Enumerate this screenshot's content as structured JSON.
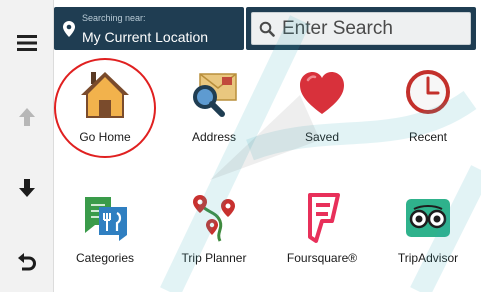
{
  "location": {
    "caption": "Searching near:",
    "value": "My Current Location"
  },
  "search": {
    "placeholder": "Enter Search"
  },
  "rail": {
    "icons": [
      "menu-icon",
      "up-arrow-icon",
      "down-arrow-icon",
      "back-icon"
    ]
  },
  "tiles": [
    {
      "label": "Go Home",
      "icon": "home-icon",
      "selected": true
    },
    {
      "label": "Address",
      "icon": "address-icon"
    },
    {
      "label": "Saved",
      "icon": "heart-icon"
    },
    {
      "label": "Recent",
      "icon": "clock-icon"
    },
    {
      "label": "Categories",
      "icon": "categories-icon"
    },
    {
      "label": "Trip Planner",
      "icon": "trip-planner-icon"
    },
    {
      "label": "Foursquare®",
      "icon": "foursquare-icon"
    },
    {
      "label": "TripAdvisor",
      "icon": "tripadvisor-icon"
    }
  ],
  "colors": {
    "topbar": "#1f3d52",
    "highlight": "#e02020",
    "heart": "#d8313b",
    "foursquare": "#e8305a",
    "tripadvisor": "#2fb28c"
  }
}
